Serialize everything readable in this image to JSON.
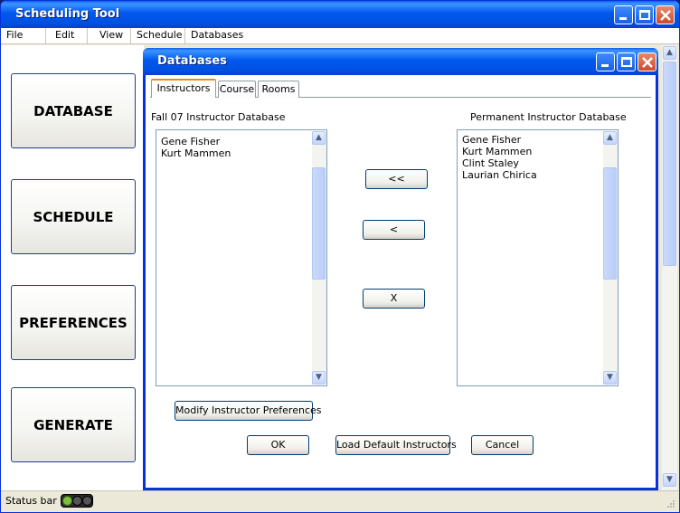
{
  "window": {
    "title": "Scheduling Tool"
  },
  "menu": [
    "File",
    "Edit",
    "View",
    "Schedule",
    "Databases"
  ],
  "sidebar": {
    "buttons": [
      "DATABASE",
      "SCHEDULE",
      "PREFERENCES",
      "GENERATE"
    ]
  },
  "dialog": {
    "title": "Databases",
    "tabs": [
      "Instructors",
      "Course",
      "Rooms"
    ],
    "active_tab": "Instructors",
    "left_list": {
      "label": "Fall 07 Instructor Database",
      "items": [
        "Gene Fisher",
        "Kurt Mammen"
      ]
    },
    "right_list": {
      "label": "Permanent Instructor Database",
      "items": [
        "Gene Fisher",
        "Kurt Mammen",
        "Clint Staley",
        "Laurian Chirica"
      ]
    },
    "transfer_buttons": {
      "all": "<<",
      "one": "<",
      "remove": "X"
    },
    "modify_button": "Modify Instructor Preferences",
    "ok_button": "OK",
    "load_default_button": "Load Default Instructors",
    "cancel_button": "Cancel"
  },
  "statusbar": {
    "text": "Status bar"
  },
  "colors": {
    "titlebar": "#0058ee",
    "accent_tab": "#e68b2c",
    "close_button": "#d0492a"
  }
}
